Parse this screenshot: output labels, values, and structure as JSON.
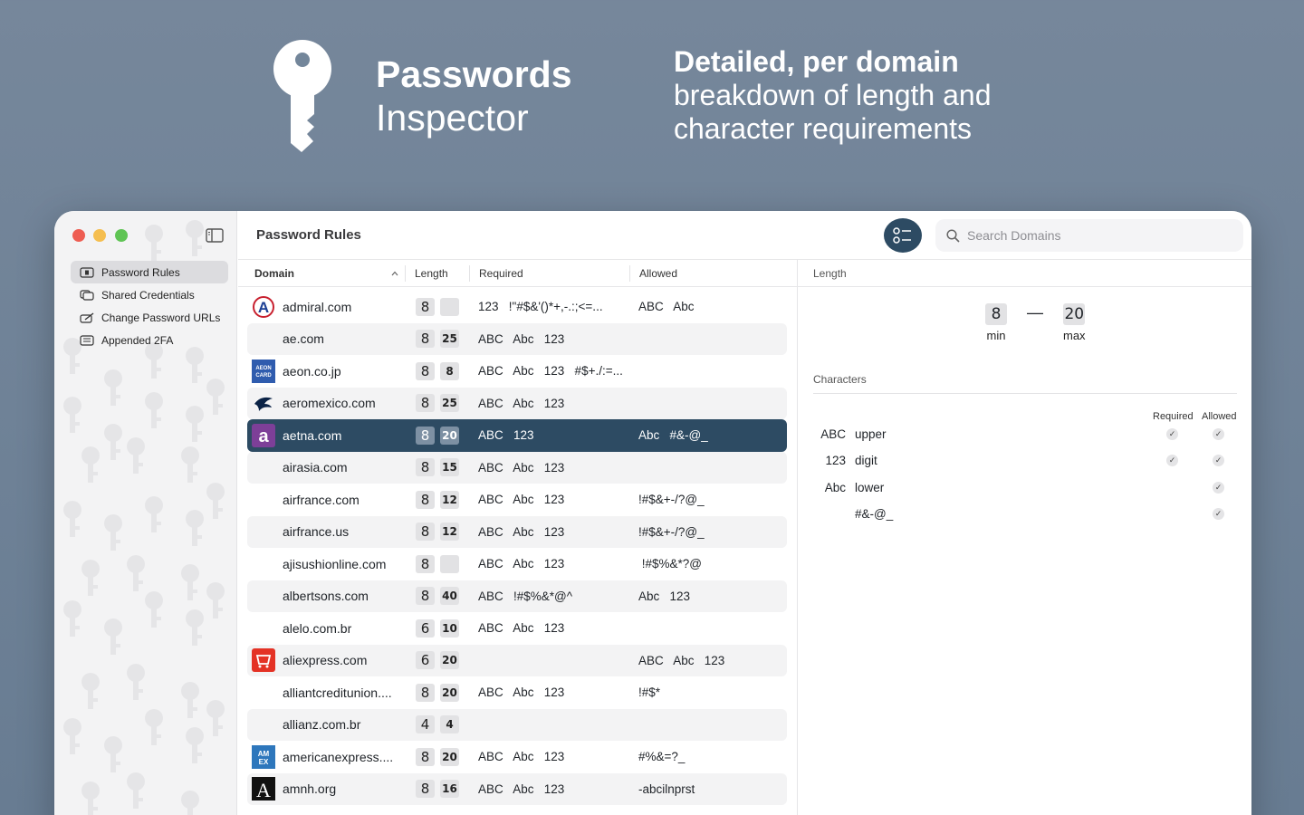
{
  "hero": {
    "title_bold": "Passwords",
    "title_light": "Inspector",
    "tagline_bold": "Detailed, per domain",
    "tagline_line2": "breakdown of length and",
    "tagline_line3": "character requirements"
  },
  "sidebar": {
    "items": [
      {
        "label": "Password Rules",
        "icon": "key-box-icon",
        "active": true
      },
      {
        "label": "Shared Credentials",
        "icon": "overlap-icon",
        "active": false
      },
      {
        "label": "Change Password URLs",
        "icon": "pencil-box-icon",
        "active": false
      },
      {
        "label": "Appended 2FA",
        "icon": "keyboard-icon",
        "active": false
      }
    ]
  },
  "toolbar": {
    "title": "Password Rules",
    "search_placeholder": "Search Domains"
  },
  "table": {
    "headers": {
      "domain": "Domain",
      "length": "Length",
      "required": "Required",
      "allowed": "Allowed"
    },
    "rows": [
      {
        "domain": "admiral.com",
        "min": "8",
        "max": "",
        "required": "123   !\"#$&'()*+,-.:;<=...",
        "allowed": "ABC   Abc",
        "logo": "admiral"
      },
      {
        "domain": "ae.com",
        "min": "8",
        "max": "25",
        "required": "ABC   Abc   123",
        "allowed": "",
        "logo": ""
      },
      {
        "domain": "aeon.co.jp",
        "min": "8",
        "max": "8",
        "required": "ABC   Abc   123   #$+./:=...",
        "allowed": "",
        "logo": "aeon"
      },
      {
        "domain": "aeromexico.com",
        "min": "8",
        "max": "25",
        "required": "ABC   Abc   123",
        "allowed": "",
        "logo": "aeromexico"
      },
      {
        "domain": "aetna.com",
        "min": "8",
        "max": "20",
        "required": "ABC   123",
        "allowed": "Abc   #&-@_",
        "logo": "aetna",
        "selected": true
      },
      {
        "domain": "airasia.com",
        "min": "8",
        "max": "15",
        "required": "ABC   Abc   123",
        "allowed": "",
        "logo": ""
      },
      {
        "domain": "airfrance.com",
        "min": "8",
        "max": "12",
        "required": "ABC   Abc   123",
        "allowed": "!#$&+-/?@_",
        "logo": ""
      },
      {
        "domain": "airfrance.us",
        "min": "8",
        "max": "12",
        "required": "ABC   Abc   123",
        "allowed": "!#$&+-/?@_",
        "logo": ""
      },
      {
        "domain": "ajisushionline.com",
        "min": "8",
        "max": "",
        "required": "ABC   Abc   123",
        "allowed": " !#$%&*?@",
        "logo": ""
      },
      {
        "domain": "albertsons.com",
        "min": "8",
        "max": "40",
        "required": "ABC   !#$%&*@^",
        "allowed": "Abc   123",
        "logo": ""
      },
      {
        "domain": "alelo.com.br",
        "min": "6",
        "max": "10",
        "required": "ABC   Abc   123",
        "allowed": "",
        "logo": ""
      },
      {
        "domain": "aliexpress.com",
        "min": "6",
        "max": "20",
        "required": "",
        "allowed": "ABC   Abc   123",
        "logo": "aliexpress"
      },
      {
        "domain": "alliantcreditunion....",
        "min": "8",
        "max": "20",
        "required": "ABC   Abc   123",
        "allowed": "!#$*",
        "logo": ""
      },
      {
        "domain": "allianz.com.br",
        "min": "4",
        "max": "4",
        "required": "",
        "allowed": "",
        "logo": ""
      },
      {
        "domain": "americanexpress....",
        "min": "8",
        "max": "20",
        "required": "ABC   Abc   123",
        "allowed": "#%&=?_",
        "logo": "amex"
      },
      {
        "domain": "amnh.org",
        "min": "8",
        "max": "16",
        "required": "ABC   Abc   123",
        "allowed": "-abcilnprst",
        "logo": "amnh"
      }
    ]
  },
  "detail": {
    "length_header": "Length",
    "min": "8",
    "max": "20",
    "min_label": "min",
    "max_label": "max",
    "characters_header": "Characters",
    "required_head": "Required",
    "allowed_head": "Allowed",
    "chars": [
      {
        "code": "ABC",
        "name": "upper",
        "required": true,
        "allowed": true
      },
      {
        "code": "123",
        "name": "digit",
        "required": true,
        "allowed": true
      },
      {
        "code": "Abc",
        "name": "lower",
        "required": false,
        "allowed": true
      },
      {
        "code": "",
        "name": "#&-@_",
        "required": false,
        "allowed": true
      }
    ]
  },
  "colors": {
    "accent": "#2d4b63",
    "background": "#73869a"
  }
}
